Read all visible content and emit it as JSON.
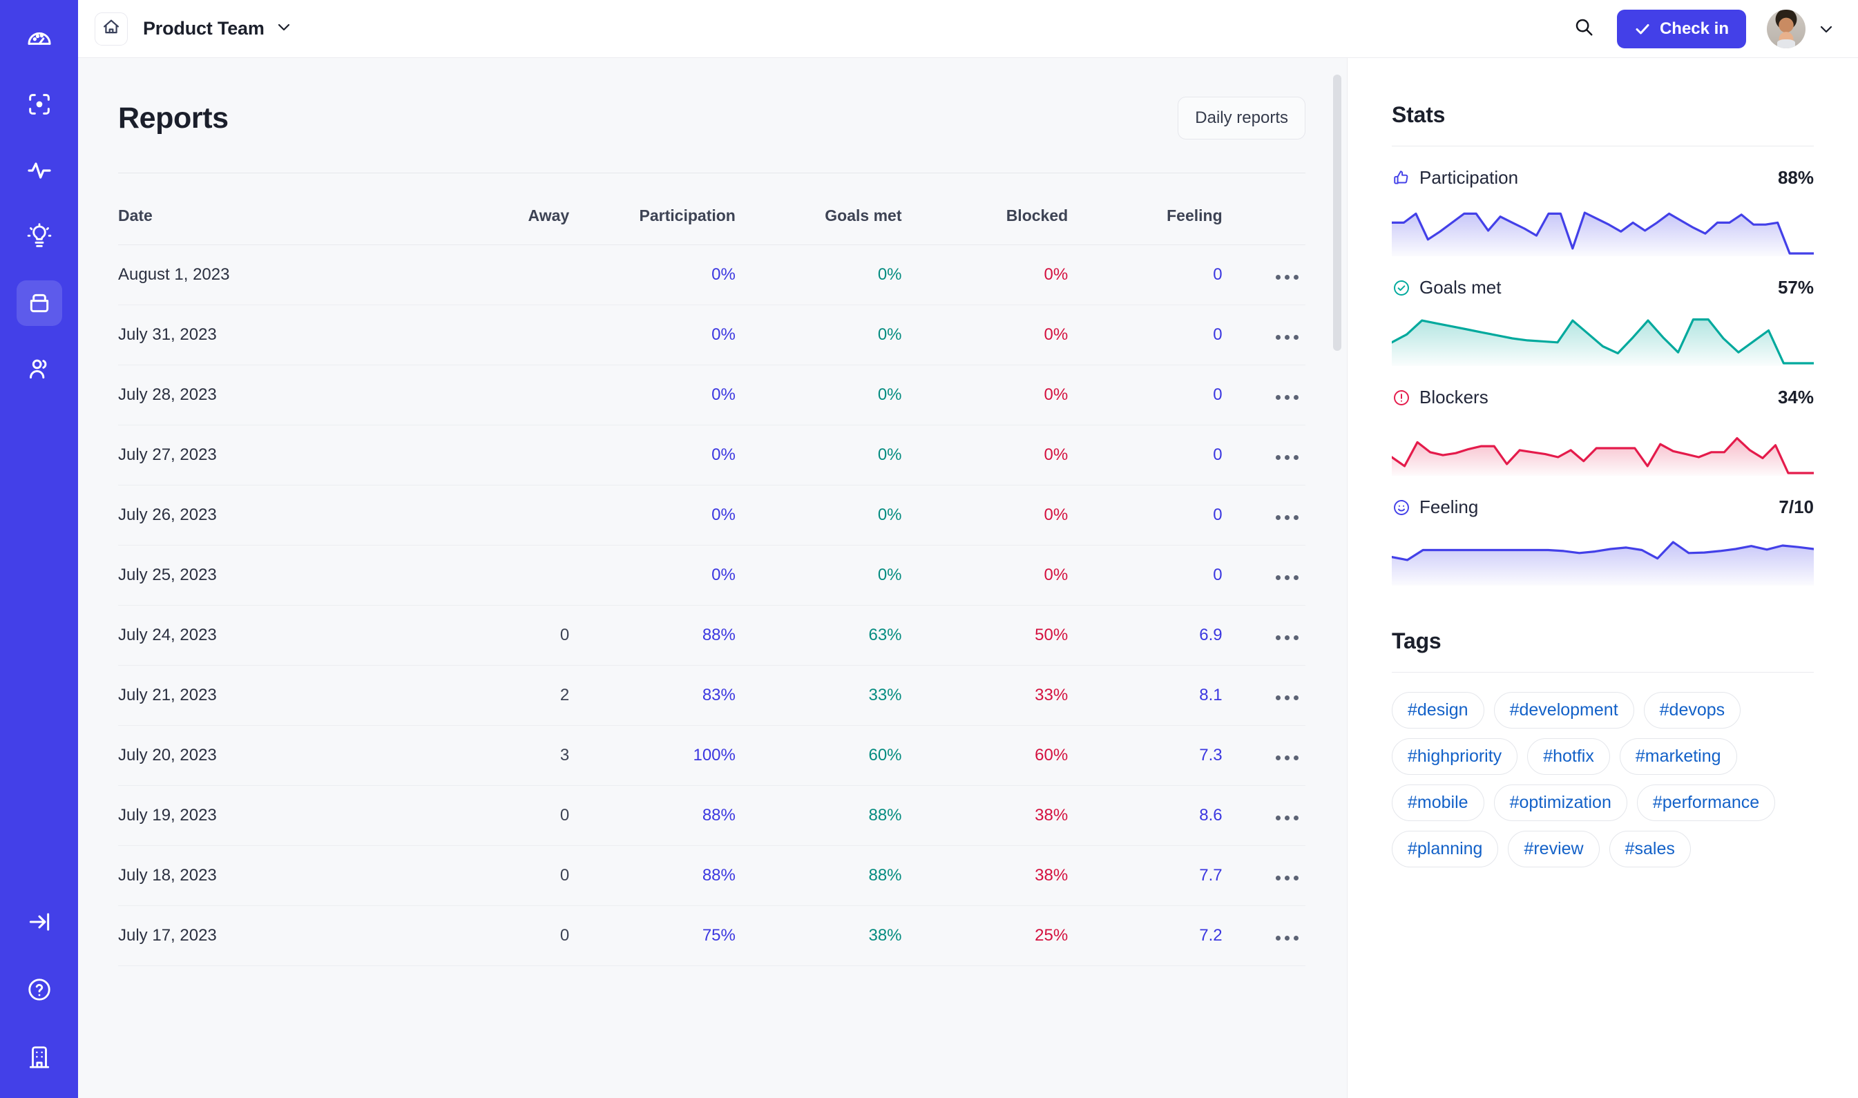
{
  "sidebar": {
    "items": [
      {
        "name": "dashboard",
        "icon": "gauge-icon",
        "active": false
      },
      {
        "name": "focus",
        "icon": "focus-target-icon",
        "active": false
      },
      {
        "name": "activity",
        "icon": "pulse-activity-icon",
        "active": false
      },
      {
        "name": "insights",
        "icon": "lightbulb-icon",
        "active": false
      },
      {
        "name": "reports",
        "icon": "archive-box-icon",
        "active": true
      },
      {
        "name": "people",
        "icon": "users-icon",
        "active": false
      }
    ],
    "bottom_items": [
      {
        "name": "collapse",
        "icon": "collapse-arrow-icon"
      },
      {
        "name": "help",
        "icon": "question-circle-icon"
      },
      {
        "name": "organization",
        "icon": "building-icon"
      }
    ]
  },
  "topbar": {
    "home_icon": "home-icon",
    "team_name": "Product Team",
    "team_chevron": "chevron-down-icon",
    "search_icon": "search-icon",
    "checkin_label": "Check in",
    "checkin_icon": "check-icon",
    "avatar": "user-avatar",
    "avatar_chevron": "chevron-down-icon"
  },
  "main": {
    "title": "Reports",
    "daily_reports_label": "Daily reports",
    "table": {
      "headers": [
        "Date",
        "Away",
        "Participation",
        "Goals met",
        "Blocked",
        "Feeling"
      ],
      "rows": [
        {
          "date": "August 1, 2023",
          "away": "",
          "participation": "0%",
          "goals": "0%",
          "blocked": "0%",
          "feeling": "0"
        },
        {
          "date": "July 31, 2023",
          "away": "",
          "participation": "0%",
          "goals": "0%",
          "blocked": "0%",
          "feeling": "0"
        },
        {
          "date": "July 28, 2023",
          "away": "",
          "participation": "0%",
          "goals": "0%",
          "blocked": "0%",
          "feeling": "0"
        },
        {
          "date": "July 27, 2023",
          "away": "",
          "participation": "0%",
          "goals": "0%",
          "blocked": "0%",
          "feeling": "0"
        },
        {
          "date": "July 26, 2023",
          "away": "",
          "participation": "0%",
          "goals": "0%",
          "blocked": "0%",
          "feeling": "0"
        },
        {
          "date": "July 25, 2023",
          "away": "",
          "participation": "0%",
          "goals": "0%",
          "blocked": "0%",
          "feeling": "0"
        },
        {
          "date": "July 24, 2023",
          "away": "0",
          "participation": "88%",
          "goals": "63%",
          "blocked": "50%",
          "feeling": "6.9"
        },
        {
          "date": "July 21, 2023",
          "away": "2",
          "participation": "83%",
          "goals": "33%",
          "blocked": "33%",
          "feeling": "8.1"
        },
        {
          "date": "July 20, 2023",
          "away": "3",
          "participation": "100%",
          "goals": "60%",
          "blocked": "60%",
          "feeling": "7.3"
        },
        {
          "date": "July 19, 2023",
          "away": "0",
          "participation": "88%",
          "goals": "88%",
          "blocked": "38%",
          "feeling": "8.6"
        },
        {
          "date": "July 18, 2023",
          "away": "0",
          "participation": "88%",
          "goals": "88%",
          "blocked": "38%",
          "feeling": "7.7"
        },
        {
          "date": "July 17, 2023",
          "away": "0",
          "participation": "75%",
          "goals": "38%",
          "blocked": "25%",
          "feeling": "7.2"
        }
      ],
      "row_menu_icon": "ellipsis-icon"
    }
  },
  "panel": {
    "stats_title": "Stats",
    "stats": [
      {
        "label": "Participation",
        "value": "88%",
        "icon": "thumbs-up-icon",
        "color": "#4340e8"
      },
      {
        "label": "Goals met",
        "value": "57%",
        "icon": "check-circle-icon",
        "color": "#00a99d"
      },
      {
        "label": "Blockers",
        "value": "34%",
        "icon": "alert-circle-icon",
        "color": "#e41b4b"
      },
      {
        "label": "Feeling",
        "value": "7/10",
        "icon": "smiley-face-icon",
        "color": "#4340e8"
      }
    ],
    "tags_title": "Tags",
    "tags": [
      "#design",
      "#development",
      "#devops",
      "#highpriority",
      "#hotfix",
      "#marketing",
      "#mobile",
      "#optimization",
      "#performance",
      "#planning",
      "#review",
      "#sales"
    ]
  },
  "chart_data": [
    {
      "type": "line",
      "title": "Participation",
      "ylabel": "%",
      "ylim": [
        0,
        100
      ],
      "values": [
        62,
        62,
        80,
        28,
        44,
        62,
        80,
        80,
        46,
        74,
        62,
        50,
        36,
        80,
        80,
        10,
        82,
        70,
        58,
        44,
        62,
        46,
        62,
        80,
        66,
        52,
        40,
        62,
        62,
        78,
        58,
        58,
        62,
        0,
        0,
        0
      ]
    },
    {
      "type": "line",
      "title": "Goals met",
      "ylabel": "%",
      "ylim": [
        0,
        100
      ],
      "values": [
        42,
        58,
        86,
        80,
        74,
        68,
        62,
        56,
        50,
        46,
        44,
        42,
        86,
        60,
        34,
        20,
        52,
        86,
        52,
        22,
        88,
        88,
        50,
        22,
        44,
        66,
        0,
        0,
        0
      ]
    },
    {
      "type": "line",
      "title": "Blockers",
      "ylabel": "%",
      "ylim": [
        0,
        100
      ],
      "values": [
        32,
        14,
        62,
        42,
        36,
        40,
        48,
        54,
        54,
        18,
        46,
        42,
        38,
        32,
        46,
        24,
        50,
        50,
        50,
        50,
        14,
        58,
        44,
        38,
        32,
        42,
        42,
        70,
        46,
        30,
        56,
        0,
        0,
        0
      ]
    },
    {
      "type": "line",
      "title": "Feeling",
      "ylabel": "score",
      "ylim": [
        0,
        10
      ],
      "values": [
        5.2,
        4.6,
        6.6,
        6.6,
        6.6,
        6.6,
        6.6,
        6.6,
        6.6,
        6.6,
        6.6,
        6.4,
        6.0,
        6.3,
        6.8,
        7.1,
        6.6,
        4.9,
        8.2,
        6.0,
        6.1,
        6.4,
        6.8,
        7.4,
        6.7,
        7.5,
        7.2,
        6.8
      ]
    }
  ],
  "colors": {
    "brand": "#4340e8",
    "participation": "#3b37e0",
    "goals": "#058c80",
    "blocked": "#d4113f",
    "tag_text": "#1361c8",
    "main_bg": "#f7f8fa"
  }
}
